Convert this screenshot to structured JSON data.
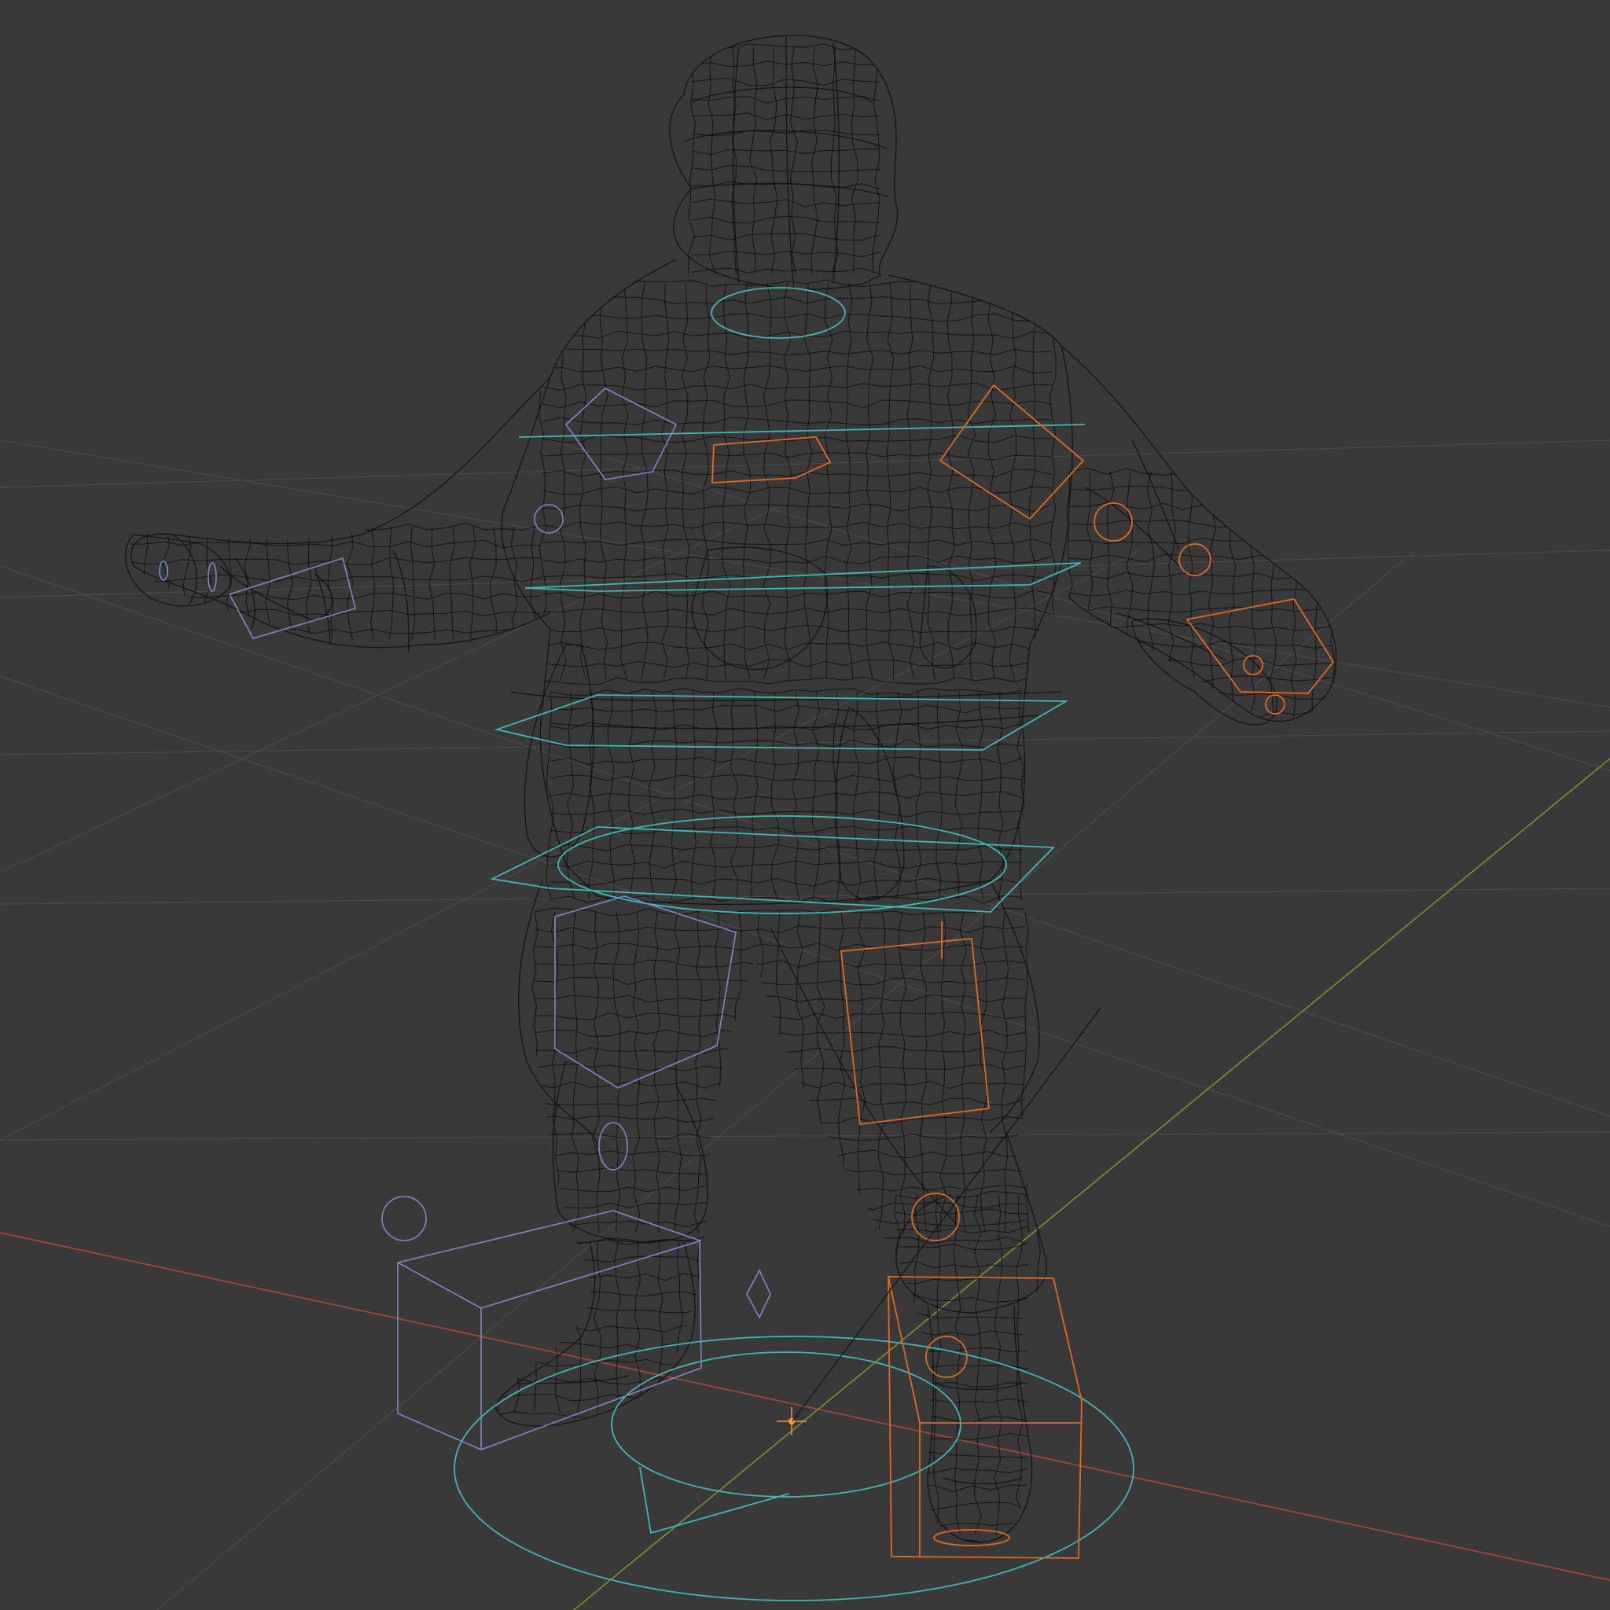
{
  "viewport": {
    "mode": "wireframe",
    "subject": "rigged-character-mesh"
  },
  "colors": {
    "background": "#393939",
    "grid": "#4a4a4a",
    "axis_x": "#c0392b",
    "axis_y": "#8a9a2a",
    "mesh_wire": "#141414",
    "controls_center": "#3fb7b9",
    "controls_left": "#7f86c8",
    "controls_right": "#e06a1d",
    "origin": "#ff9a2a"
  },
  "icons": {
    "origin": "origin-icon",
    "object_center": "pivot-icon"
  }
}
